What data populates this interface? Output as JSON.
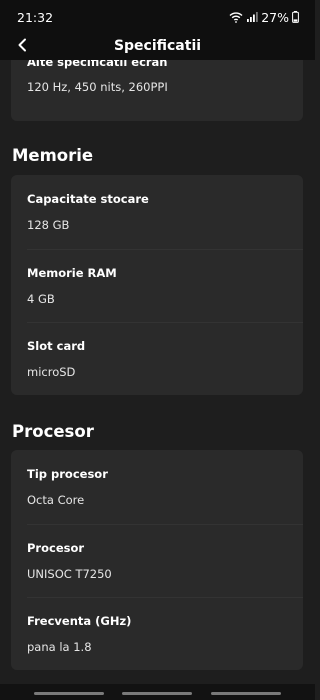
{
  "status_bar": {
    "time": "21:32",
    "battery_percent": "27%",
    "icons": [
      "wifi-icon",
      "signal-icon",
      "battery-icon"
    ]
  },
  "app_bar": {
    "title": "Specificatii",
    "back_icon": "chevron-left-icon"
  },
  "sections": {
    "ecran": {
      "items": [
        {
          "label": "Alte specificatii ecran",
          "value": "120 Hz, 450 nits, 260PPI"
        }
      ]
    },
    "memorie": {
      "title": "Memorie",
      "items": [
        {
          "label": "Capacitate stocare",
          "value": "128 GB"
        },
        {
          "label": "Memorie RAM",
          "value": "4 GB"
        },
        {
          "label": "Slot card",
          "value": "microSD"
        }
      ]
    },
    "procesor": {
      "title": "Procesor",
      "items": [
        {
          "label": "Tip procesor",
          "value": "Octa Core"
        },
        {
          "label": "Procesor",
          "value": "UNISOC T7250"
        },
        {
          "label": "Frecventa (GHz)",
          "value": "pana la 1.8"
        }
      ]
    }
  },
  "colors": {
    "background": "#1e1e1e",
    "card": "#2a2a2a",
    "bars": "#0f0f0f",
    "text": "#ffffff"
  }
}
